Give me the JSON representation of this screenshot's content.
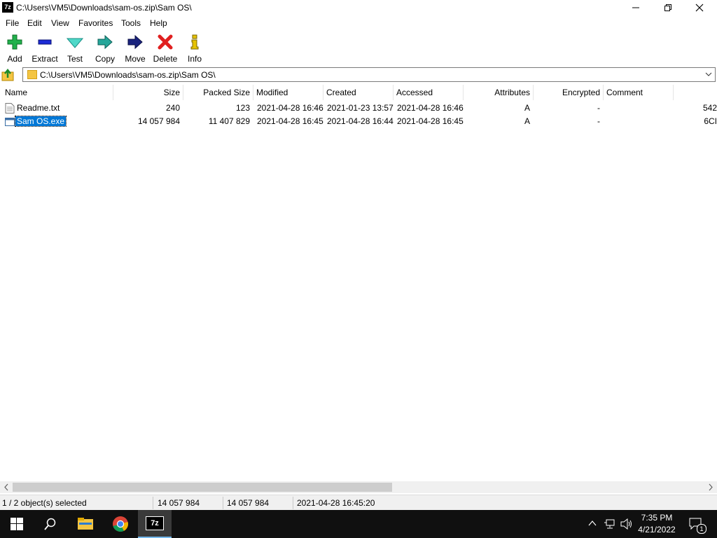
{
  "window": {
    "app_icon_text": "7z",
    "title": "C:\\Users\\VM5\\Downloads\\sam-os.zip\\Sam OS\\"
  },
  "menu": [
    "File",
    "Edit",
    "View",
    "Favorites",
    "Tools",
    "Help"
  ],
  "toolbar": [
    {
      "label": "Add",
      "icon": "plus-icon"
    },
    {
      "label": "Extract",
      "icon": "minus-icon"
    },
    {
      "label": "Test",
      "icon": "check-arrow-icon"
    },
    {
      "label": "Copy",
      "icon": "copy-arrow-icon"
    },
    {
      "label": "Move",
      "icon": "move-arrow-icon"
    },
    {
      "label": "Delete",
      "icon": "delete-x-icon"
    },
    {
      "label": "Info",
      "icon": "info-icon"
    }
  ],
  "address": {
    "path": "C:\\Users\\VM5\\Downloads\\sam-os.zip\\Sam OS\\"
  },
  "columns": [
    "Name",
    "Size",
    "Packed Size",
    "Modified",
    "Created",
    "Accessed",
    "Attributes",
    "Encrypted",
    "Comment"
  ],
  "files": [
    {
      "name": "Readme.txt",
      "size": "240",
      "packed": "123",
      "modified": "2021-04-28 16:46",
      "created": "2021-01-23 13:57",
      "accessed": "2021-04-28 16:46",
      "attributes": "A",
      "encrypted": "-",
      "comment": "",
      "crc": "542",
      "selected": false
    },
    {
      "name": "Sam OS.exe",
      "size": "14 057 984",
      "packed": "11 407 829",
      "modified": "2021-04-28 16:45",
      "created": "2021-04-28 16:44",
      "accessed": "2021-04-28 16:45",
      "attributes": "A",
      "encrypted": "-",
      "comment": "",
      "crc": "6CI",
      "selected": true
    }
  ],
  "status": {
    "selection": "1 / 2 object(s) selected",
    "size": "14 057 984",
    "packed": "14 057 984",
    "modified": "2021-04-28 16:45:20"
  },
  "taskbar": {
    "time": "7:35 PM",
    "date": "4/21/2022",
    "notification_count": "1",
    "active_app_label": "7z"
  },
  "colors": {
    "selection": "#0078d7",
    "taskbar": "#101010"
  }
}
